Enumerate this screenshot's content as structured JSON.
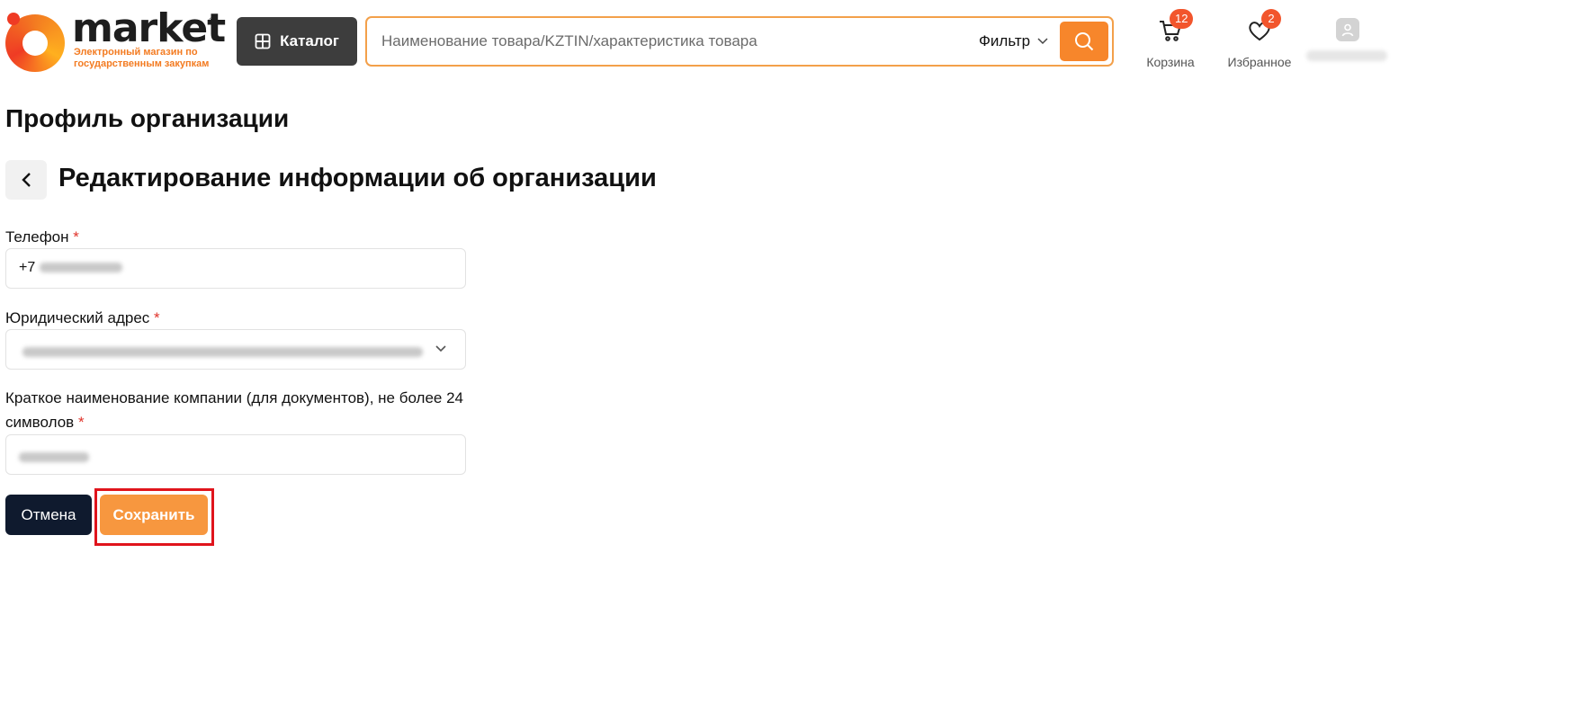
{
  "header": {
    "logo": {
      "word": "market",
      "reg": "®",
      "tagline": "Электронный магазин по государственным закупкам"
    },
    "catalog_label": "Каталог",
    "search_placeholder": "Наименование товара/KZTIN/характеристика товара",
    "filter_label": "Фильтр",
    "cart": {
      "label": "Корзина",
      "count": "12"
    },
    "favorites": {
      "label": "Избранное",
      "count": "2"
    }
  },
  "page": {
    "title": "Профиль организации",
    "section_title": "Редактирование информации об организации"
  },
  "form": {
    "phone": {
      "label": "Телефон",
      "required_mark": "*",
      "value_prefix": "+7"
    },
    "address": {
      "label": "Юридический адрес",
      "required_mark": "*"
    },
    "short_name": {
      "label": "Краткое наименование компании (для документов), не более 24 символов",
      "required_mark": "*"
    },
    "cancel_label": "Отмена",
    "save_label": "Сохранить"
  },
  "icons": {
    "catalog": "grid-icon",
    "search": "search-icon",
    "filter": "chevron-down-icon",
    "cart": "cart-icon",
    "favorites": "heart-icon",
    "profile": "user-icon",
    "back": "chevron-left-icon",
    "address_dropdown": "chevron-down-icon"
  },
  "colors": {
    "accent": "#f7862b",
    "catalog_bg": "#3d3d3d",
    "cancel_bg": "#0f1a2e",
    "badge": "#f2552c",
    "required": "#e0332b",
    "highlight": "#e0141c"
  }
}
